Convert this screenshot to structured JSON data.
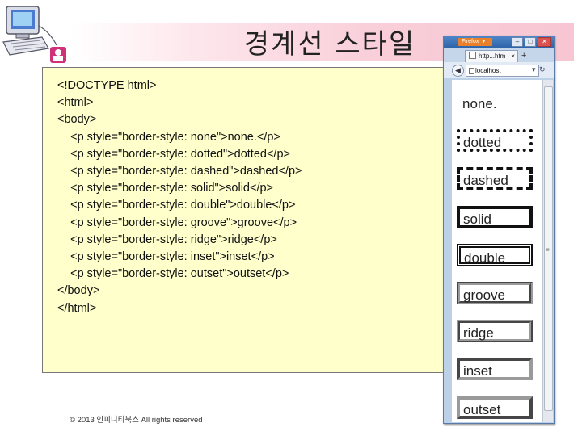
{
  "slide": {
    "title": "경계선 스타일",
    "footer": "© 2013 인피니티북스 All rights reserved"
  },
  "code_lines": [
    "<!DOCTYPE html>",
    "<html>",
    "<body>",
    "    <p style=\"border-style: none\">none.</p>",
    "    <p style=\"border-style: dotted\">dotted</p>",
    "    <p style=\"border-style: dashed\">dashed</p>",
    "    <p style=\"border-style: solid\">solid</p>",
    "    <p style=\"border-style: double\">double</p>",
    "    <p style=\"border-style: groove\">groove</p>",
    "    <p style=\"border-style: ridge\">ridge</p>",
    "    <p style=\"border-style: inset\">inset</p>",
    "    <p style=\"border-style: outset\">outset</p>",
    "</body>",
    "</html>"
  ],
  "browser": {
    "app_button": "Firefox",
    "tab_title": "http...htm",
    "url": "localhost",
    "items": [
      {
        "label": "none.",
        "style": "none"
      },
      {
        "label": "dotted",
        "style": "dotted"
      },
      {
        "label": "dashed",
        "style": "dashed"
      },
      {
        "label": "solid",
        "style": "solid"
      },
      {
        "label": "double",
        "style": "double"
      },
      {
        "label": "groove",
        "style": "groove"
      },
      {
        "label": "ridge",
        "style": "ridge"
      },
      {
        "label": "inset",
        "style": "inset"
      },
      {
        "label": "outset",
        "style": "outset"
      }
    ]
  },
  "colors": {
    "title_band": "#f7c6d2",
    "code_background": "#ffffcc",
    "firefox_orange": "#e8802c"
  }
}
